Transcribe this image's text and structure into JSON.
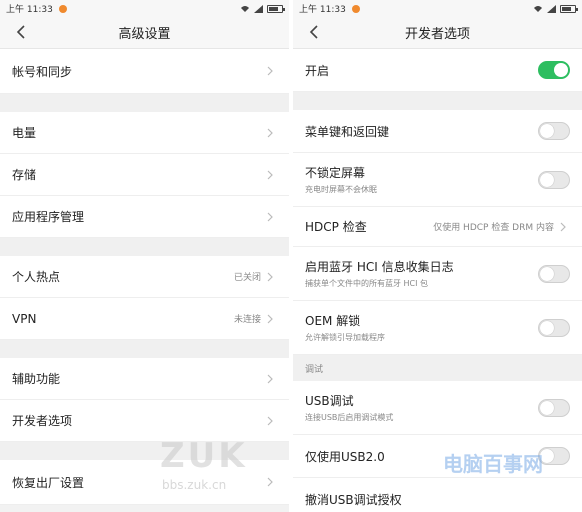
{
  "statusbar": {
    "time": "上午 11:33"
  },
  "left": {
    "title": "高级设置",
    "items": [
      {
        "label": "帐号和同步"
      },
      {
        "label": "电量"
      },
      {
        "label": "存储"
      },
      {
        "label": "应用程序管理"
      },
      {
        "label": "个人热点",
        "value": "已关闭"
      },
      {
        "label": "VPN",
        "value": "未连接"
      },
      {
        "label": "辅助功能"
      },
      {
        "label": "开发者选项"
      },
      {
        "label": "恢复出厂设置"
      }
    ]
  },
  "right": {
    "title": "开发者选项",
    "enable_label": "开启",
    "enable_on": true,
    "items": [
      {
        "label": "菜单键和返回键",
        "on": false
      },
      {
        "label": "不锁定屏幕",
        "sub": "充电时屏幕不会休眠",
        "on": false
      },
      {
        "label": "HDCP 检查",
        "value": "仅使用 HDCP 检查 DRM 内容"
      },
      {
        "label": "启用蓝牙 HCI 信息收集日志",
        "sub": "捕获单个文件中的所有蓝牙 HCI 包",
        "on": false
      },
      {
        "label": "OEM 解锁",
        "sub": "允许解锁引导加载程序",
        "on": false
      }
    ],
    "section_debug": "调试",
    "debug_items": [
      {
        "label": "USB调试",
        "sub": "连接USB后启用调试模式",
        "on": false
      },
      {
        "label": "仅使用USB2.0",
        "on": false
      },
      {
        "label": "撤消USB调试授权"
      }
    ]
  },
  "watermarks": {
    "zuk": "ZUK",
    "zuk_url": "bbs.zuk.cn",
    "site": "电脑百事网"
  },
  "colors": {
    "toggle_on": "#2dbe60",
    "status_dot": "#f08a2e"
  },
  "icons": [
    "back-arrow-icon",
    "chevron-right-icon",
    "wifi-icon",
    "signal-icon",
    "battery-icon"
  ]
}
